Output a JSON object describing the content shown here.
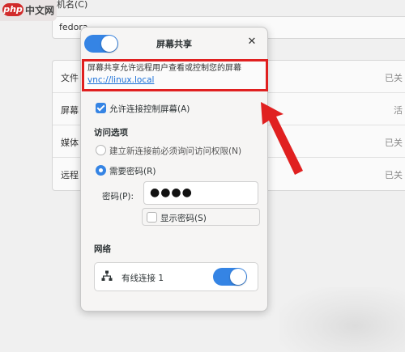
{
  "watermark": {
    "badge": "php",
    "text": "中文网"
  },
  "background": {
    "hostname_label": "机名(C)",
    "hostname_value": "fedora",
    "rows": [
      {
        "label": "文件",
        "status": "已关"
      },
      {
        "label": "屏幕",
        "status": "活"
      },
      {
        "label": "媒体",
        "status": "已关"
      },
      {
        "label": "远程",
        "status": "已关"
      }
    ]
  },
  "dialog": {
    "title": "屏幕共享",
    "header_toggle_on": true,
    "close_icon": "close-icon",
    "description": "屏幕共享允许远程用户查看或控制您的屏幕",
    "link": "vnc://linux.local",
    "allow_control": {
      "label": "允许连接控制屏幕(A)",
      "checked": true
    },
    "access_section": "访问选项",
    "access_options": [
      {
        "label": "建立新连接前必须询问访问权限(N)",
        "selected": false
      },
      {
        "label": "需要密码(R)",
        "selected": true
      }
    ],
    "password": {
      "label": "密码(P):",
      "value": "●●●●"
    },
    "show_password": {
      "label": "显示密码(S)",
      "checked": false
    },
    "network_section": "网络",
    "network": {
      "icon": "wired-network-icon",
      "label": "有线连接 1",
      "enabled": true
    }
  },
  "colors": {
    "accent": "#3584e4",
    "highlight": "#e02020",
    "link": "#1c71d8"
  }
}
